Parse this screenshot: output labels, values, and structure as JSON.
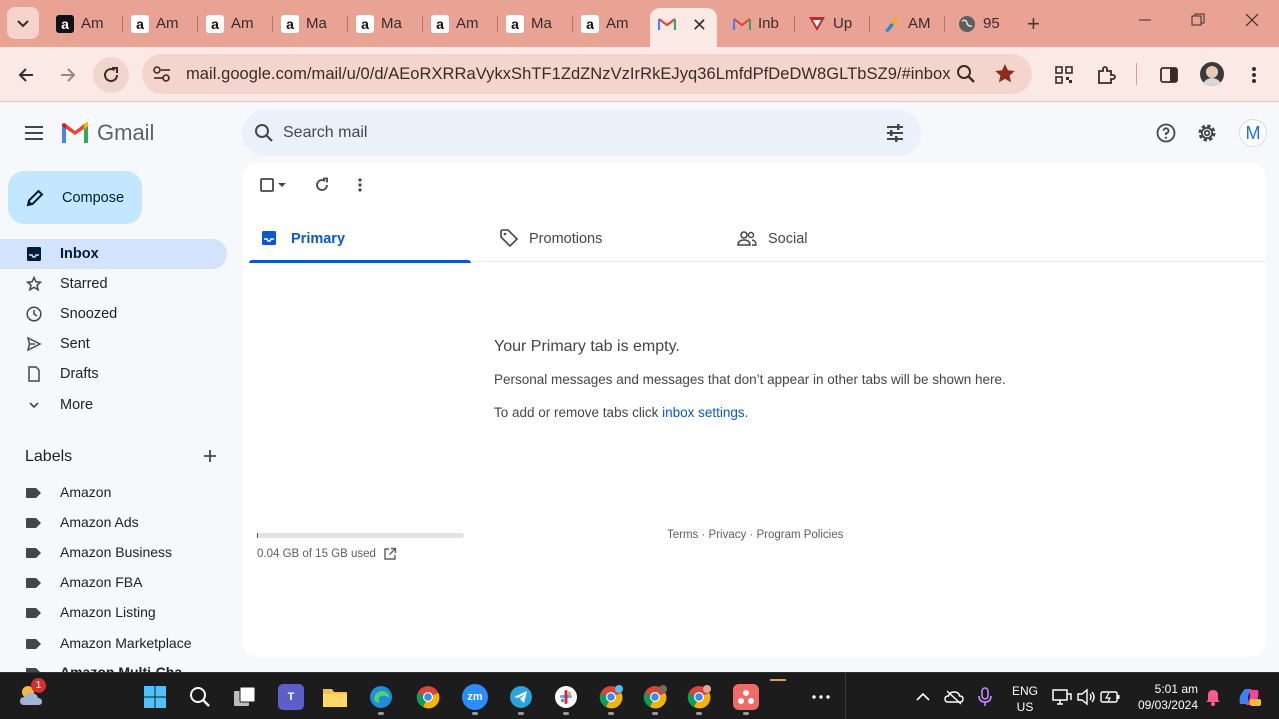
{
  "browser": {
    "tabs": [
      {
        "title": "Am",
        "favicon": "amazon-dark"
      },
      {
        "title": "Am",
        "favicon": "amazon"
      },
      {
        "title": "Am",
        "favicon": "amazon"
      },
      {
        "title": "Ma",
        "favicon": "amazon"
      },
      {
        "title": "Ma",
        "favicon": "amazon"
      },
      {
        "title": "Am",
        "favicon": "amazon"
      },
      {
        "title": "Ma",
        "favicon": "amazon"
      },
      {
        "title": "Am",
        "favicon": "amazon"
      },
      {
        "title": "",
        "favicon": "gmail",
        "active": true
      },
      {
        "title": "Inb",
        "favicon": "gmail"
      },
      {
        "title": "Up",
        "favicon": "up-arrow"
      },
      {
        "title": "AM",
        "favicon": "pen"
      },
      {
        "title": "95",
        "favicon": "globe"
      }
    ],
    "close_tab_glyph": "✕",
    "new_tab_glyph": "+",
    "url": "mail.google.com/mail/u/0/d/AEoRXRRaVykxShTF1ZdZNzVzIrRkEJyq36LmfdPfDeDW8GLTbSZ9/#inbox",
    "colors": {
      "tabstrip": "#e8a395",
      "toolbar": "#fbe9e5"
    }
  },
  "gmail": {
    "logo_text": "Gmail",
    "search_placeholder": "Search mail",
    "avatar_letter": "M",
    "compose_label": "Compose",
    "nav": [
      {
        "label": "Inbox",
        "icon": "inbox-icon",
        "active": true
      },
      {
        "label": "Starred",
        "icon": "star-icon"
      },
      {
        "label": "Snoozed",
        "icon": "clock-icon"
      },
      {
        "label": "Sent",
        "icon": "send-icon"
      },
      {
        "label": "Drafts",
        "icon": "draft-icon"
      },
      {
        "label": "More",
        "icon": "chevron-down-icon"
      }
    ],
    "labels_heading": "Labels",
    "labels": [
      {
        "name": "Amazon"
      },
      {
        "name": "Amazon Ads"
      },
      {
        "name": "Amazon Business"
      },
      {
        "name": "Amazon FBA"
      },
      {
        "name": "Amazon Listing"
      },
      {
        "name": "Amazon Marketplace"
      },
      {
        "name": "Amazon Multi-Cha"
      }
    ],
    "tabs": [
      {
        "label": "Primary",
        "active": true
      },
      {
        "label": "Promotions"
      },
      {
        "label": "Social"
      }
    ],
    "empty": {
      "title": "Your Primary tab is empty.",
      "description": "Personal messages and messages that don’t appear in other tabs will be shown here.",
      "settings_prefix": "To add or remove tabs click ",
      "settings_link": "inbox settings",
      "settings_suffix": "."
    },
    "storage": {
      "text": "0.04 GB of 15 GB used",
      "used_fraction": 0.003
    },
    "footer": "Terms · Privacy · Program Policies",
    "accent": "#0b57d0"
  },
  "taskbar": {
    "start_badge": "1",
    "language": {
      "line1": "ENG",
      "line2": "US"
    },
    "clock": {
      "time": "5:01 am",
      "date": "09/03/2024"
    }
  }
}
